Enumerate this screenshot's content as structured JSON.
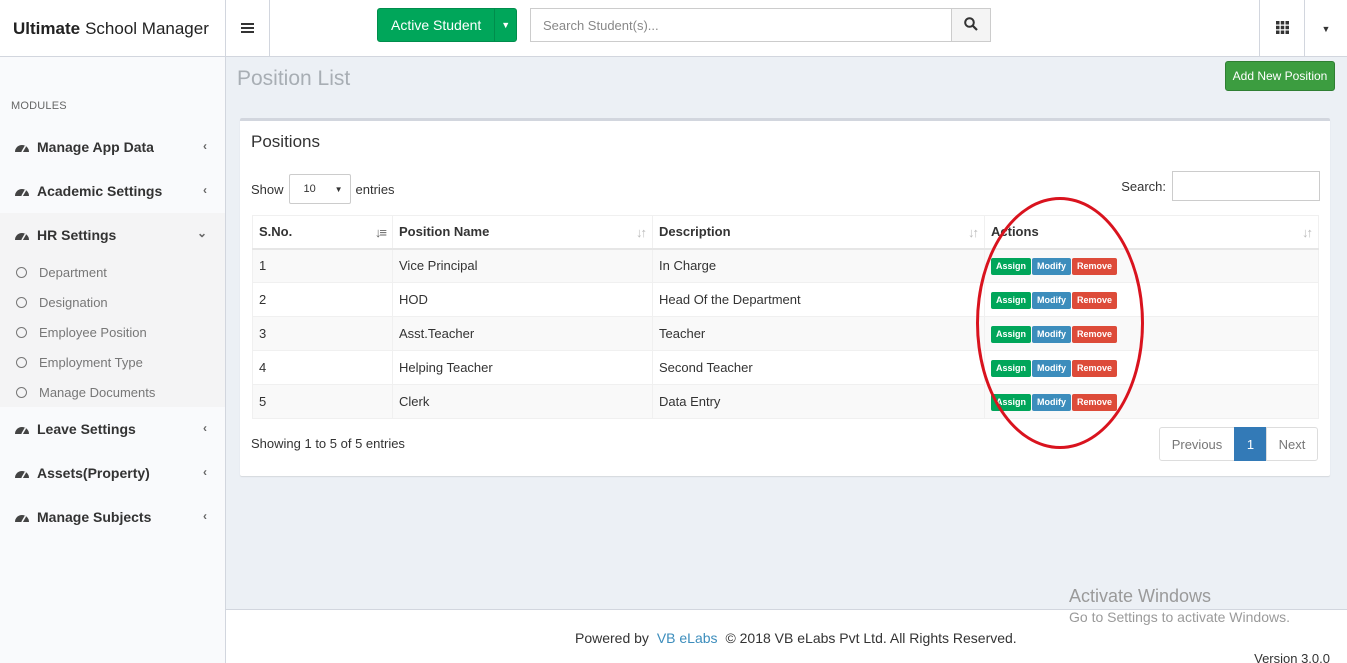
{
  "header": {
    "brand_bold": "Ultimate",
    "brand_rest": "School Manager",
    "active_student_label": "Active Student",
    "search_placeholder": "Search Student(s)..."
  },
  "sidebar": {
    "modules_label": "MODULES",
    "items": [
      {
        "label": "Manage App Data"
      },
      {
        "label": "Academic Settings"
      },
      {
        "label": "HR Settings"
      },
      {
        "label": "Leave Settings"
      },
      {
        "label": "Assets(Property)"
      },
      {
        "label": "Manage Subjects"
      }
    ],
    "hr_sub_items": [
      {
        "label": "Department"
      },
      {
        "label": "Designation"
      },
      {
        "label": "Employee Position"
      },
      {
        "label": "Employment Type"
      },
      {
        "label": "Manage Documents"
      }
    ]
  },
  "page": {
    "title": "Position List",
    "add_button": "Add New Position"
  },
  "box": {
    "title": "Positions",
    "show_label": "Show",
    "entries_label": "entries",
    "page_size": "10",
    "search_label": "Search:",
    "columns": [
      "S.No.",
      "Position Name",
      "Description",
      "Actions"
    ],
    "rows": [
      {
        "sno": "1",
        "name": "Vice Principal",
        "desc": "In Charge"
      },
      {
        "sno": "2",
        "name": "HOD",
        "desc": "Head Of the Department"
      },
      {
        "sno": "3",
        "name": "Asst.Teacher",
        "desc": "Teacher"
      },
      {
        "sno": "4",
        "name": "Helping Teacher",
        "desc": "Second Teacher"
      },
      {
        "sno": "5",
        "name": "Clerk",
        "desc": "Data Entry"
      }
    ],
    "actions": {
      "assign": "Assign",
      "modify": "Modify",
      "remove": "Remove"
    },
    "showing": "Showing 1 to 5 of 5 entries",
    "pagination": {
      "prev": "Previous",
      "current": "1",
      "next": "Next"
    }
  },
  "footer": {
    "powered_by": "Powered by",
    "vb_link": "VB eLabs",
    "copyright": "© 2018 VB eLabs Pvt Ltd. All Rights Reserved.",
    "version": "Version 3.0.0"
  },
  "watermark": {
    "line1": "Activate Windows",
    "line2": "Go to Settings to activate Windows."
  },
  "colors": {
    "success": "#00a65a",
    "primary": "#3c8dbc",
    "danger": "#dd4b39",
    "highlight": "#d9131e"
  }
}
